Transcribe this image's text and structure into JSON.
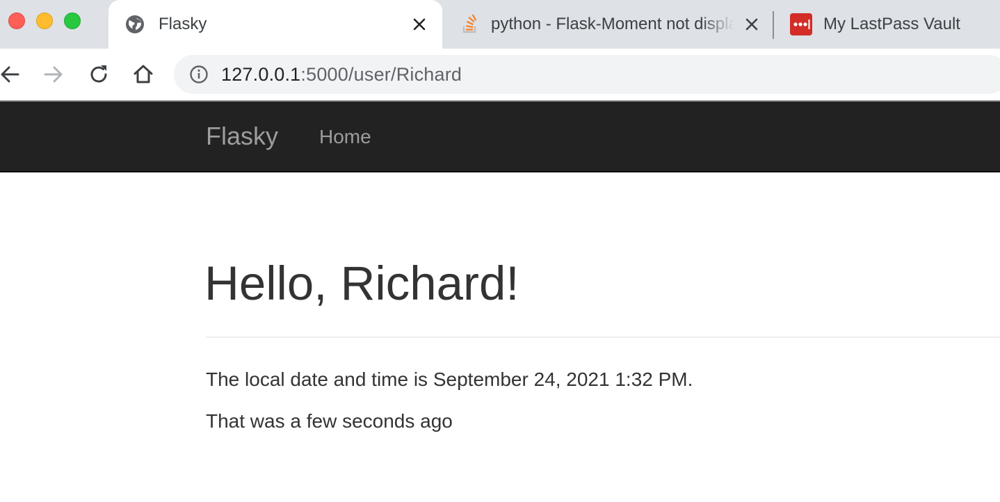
{
  "browser": {
    "tabs": [
      {
        "title": "Flasky",
        "active": true,
        "favicon": "globe-icon"
      },
      {
        "title": "python - Flask-Moment not displaying time",
        "active": false,
        "favicon": "stackoverflow-icon"
      },
      {
        "title": "My LastPass Vault",
        "active": false,
        "favicon": "lastpass-icon"
      }
    ],
    "address": {
      "host": "127.0.0.1",
      "path": ":5000/user/Richard"
    }
  },
  "navbar": {
    "brand": "Flasky",
    "links": [
      {
        "label": "Home"
      }
    ]
  },
  "page": {
    "heading": "Hello, Richard!",
    "local_time_text": "The local date and time is September 24, 2021 1:32 PM.",
    "relative_time_text": "That was a few seconds ago"
  },
  "colors": {
    "navbar_bg": "#222222",
    "navbar_link": "#9d9d9d",
    "tabstrip_bg": "#dee1e6",
    "omnibox_bg": "#f1f3f4",
    "text": "#333333",
    "lastpass_red": "#d32d27",
    "stackoverflow_orange": "#f48024"
  }
}
